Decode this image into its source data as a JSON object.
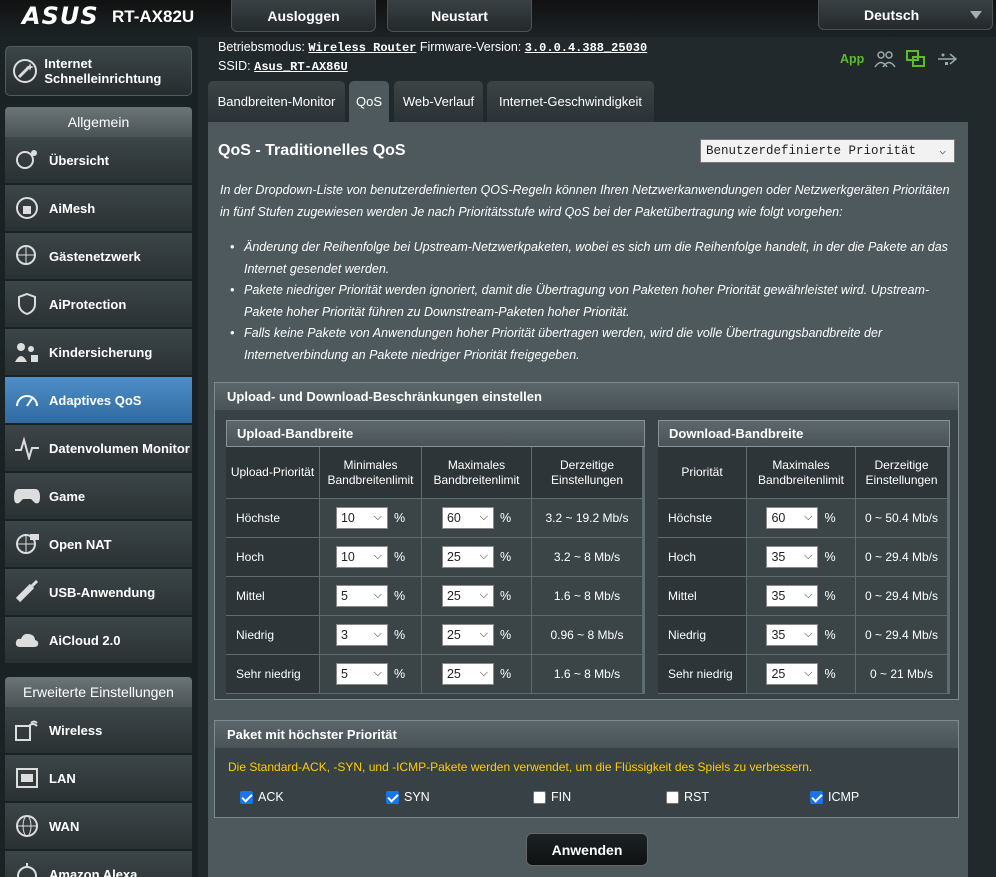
{
  "brand": "ASUS",
  "model": "RT-AX82U",
  "top": {
    "logout": "Ausloggen",
    "restart": "Neustart",
    "language": "Deutsch"
  },
  "info": {
    "mode_label": "Betriebsmodus:",
    "mode_value": "Wireless Router",
    "fw_label": "Firmware-Version:",
    "fw_value": "3.0.0.4.388_25030",
    "ssid_label": "SSID:",
    "ssid_value": "Asus_RT-AX86U",
    "app": "App"
  },
  "sidebar": {
    "quick": "Internet Schnelleinrichtung",
    "general": "Allgemein",
    "advanced": "Erweiterte Einstellungen",
    "items": [
      "Übersicht",
      "AiMesh",
      "Gästenetzwerk",
      "AiProtection",
      "Kindersicherung",
      "Adaptives QoS",
      "Datenvolumen Monitor",
      "Game",
      "Open NAT",
      "USB-Anwendung",
      "AiCloud 2.0"
    ],
    "adv_items": [
      "Wireless",
      "LAN",
      "WAN",
      "Amazon Alexa"
    ]
  },
  "tabs": [
    "Bandbreiten-Monitor",
    "QoS",
    "Web-Verlauf",
    "Internet-Geschwindigkeit"
  ],
  "qos": {
    "title": "QoS - Traditionelles QoS",
    "mode_select": "Benutzerdefinierte Priorität",
    "desc": "In der Dropdown-Liste von benutzerdefinierten QOS-Regeln können Ihren Netzwerkanwendungen oder Netzwerkgeräten Prioritäten in fünf Stufen zugewiesen werden Je nach Prioritätsstufe wird QoS bei der Paketübertragung wie folgt vorgehen:",
    "bullets": [
      "Änderung der Reihenfolge bei Upstream-Netzwerkpaketen, wobei es sich um die Reihenfolge handelt, in der die Pakete an das Internet gesendet werden.",
      "Pakete niedriger Priorität werden ignoriert, damit die Übertragung von Paketen hoher Priorität gewährleistet wird. Upstream-Pakete hoher Priorität führen zu Downstream-Paketen hoher Priorität.",
      "Falls keine Pakete von Anwendungen hoher Priorität übertragen werden, wird die volle Übertragungsbandbreite der Internetverbindung an Pakete niedriger Priorität freigegeben."
    ]
  },
  "limits": {
    "title": "Upload- und Download-Beschränkungen einstellen",
    "upload": {
      "title": "Upload-Bandbreite",
      "headers": [
        "Upload-Priorität",
        "Minimales Bandbreitenlimit",
        "Maximales Bandbreitenlimit",
        "Derzeitige Einstellungen"
      ],
      "rows": [
        {
          "p": "Höchste",
          "min": "10",
          "max": "60",
          "cur": "3.2 ~ 19.2 Mb/s"
        },
        {
          "p": "Hoch",
          "min": "10",
          "max": "25",
          "cur": "3.2 ~ 8 Mb/s"
        },
        {
          "p": "Mittel",
          "min": "5",
          "max": "25",
          "cur": "1.6 ~ 8 Mb/s"
        },
        {
          "p": "Niedrig",
          "min": "3",
          "max": "25",
          "cur": "0.96 ~ 8 Mb/s"
        },
        {
          "p": "Sehr niedrig",
          "min": "5",
          "max": "25",
          "cur": "1.6 ~ 8 Mb/s"
        }
      ]
    },
    "download": {
      "title": "Download-Bandbreite",
      "headers": [
        "Priorität",
        "Maximales Bandbreitenlimit",
        "Derzeitige Einstellungen"
      ],
      "rows": [
        {
          "p": "Höchste",
          "max": "60",
          "cur": "0 ~ 50.4 Mb/s"
        },
        {
          "p": "Hoch",
          "max": "35",
          "cur": "0 ~ 29.4 Mb/s"
        },
        {
          "p": "Mittel",
          "max": "35",
          "cur": "0 ~ 29.4 Mb/s"
        },
        {
          "p": "Niedrig",
          "max": "35",
          "cur": "0 ~ 29.4 Mb/s"
        },
        {
          "p": "Sehr niedrig",
          "max": "25",
          "cur": "0 ~ 21 Mb/s"
        }
      ]
    },
    "pct": "%"
  },
  "packet": {
    "title": "Paket mit höchster Priorität",
    "note": "Die Standard-ACK, -SYN, und -ICMP-Pakete werden verwendet, um die Flüssigkeit des Spiels zu verbessern.",
    "flags": [
      {
        "label": "ACK",
        "checked": true
      },
      {
        "label": "SYN",
        "checked": true
      },
      {
        "label": "FIN",
        "checked": false
      },
      {
        "label": "RST",
        "checked": false
      },
      {
        "label": "ICMP",
        "checked": true
      }
    ]
  },
  "apply": "Anwenden",
  "colors": {
    "accent": "#3a7fc0",
    "app_green": "#5bbd2b",
    "note": "#ffcc00",
    "panel": "#4d595d"
  }
}
